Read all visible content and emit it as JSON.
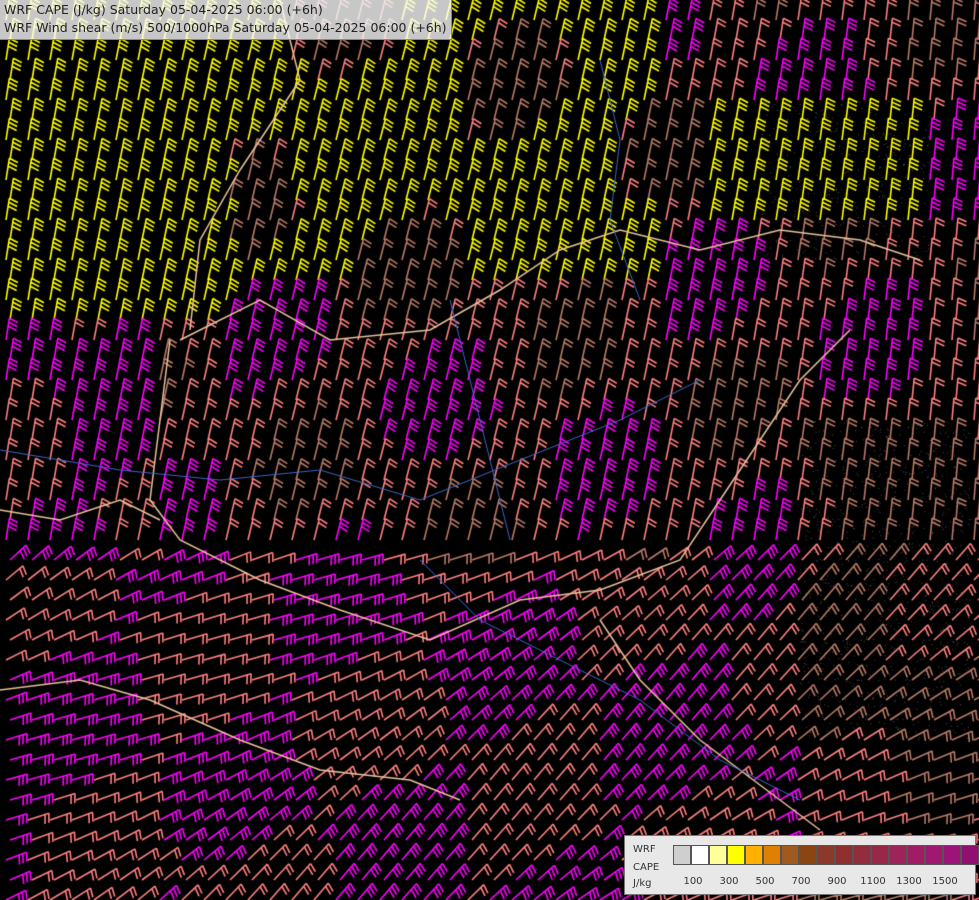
{
  "title": {
    "line1": "WRF CAPE (J/kg) Saturday 05-04-2025 06:00 (+6h)",
    "line2": "WRF Wind shear (m/s) 500/1000hPa Saturday 05-04-2025 06:00 (+6h)"
  },
  "legend": {
    "model": "WRF",
    "field": "CAPE",
    "unit": "J/kg",
    "colors": [
      "#cfcfcf",
      "#ffffff",
      "#ffff99",
      "#ffff00",
      "#ffb000",
      "#e08000",
      "#a05a20",
      "#8b4513",
      "#8b3a2a",
      "#8f3030",
      "#932c3c",
      "#982848",
      "#9c2458",
      "#a01c64",
      "#a01870",
      "#9c1478",
      "#901070"
    ],
    "ticks": [
      "100",
      "300",
      "500",
      "700",
      "900",
      "1100",
      "1300",
      "1500"
    ]
  },
  "shear_colors": {
    "low": "#ffff00",
    "mid": "#ff8080",
    "high": "#ff00ff",
    "weak": "#b87a66"
  }
}
